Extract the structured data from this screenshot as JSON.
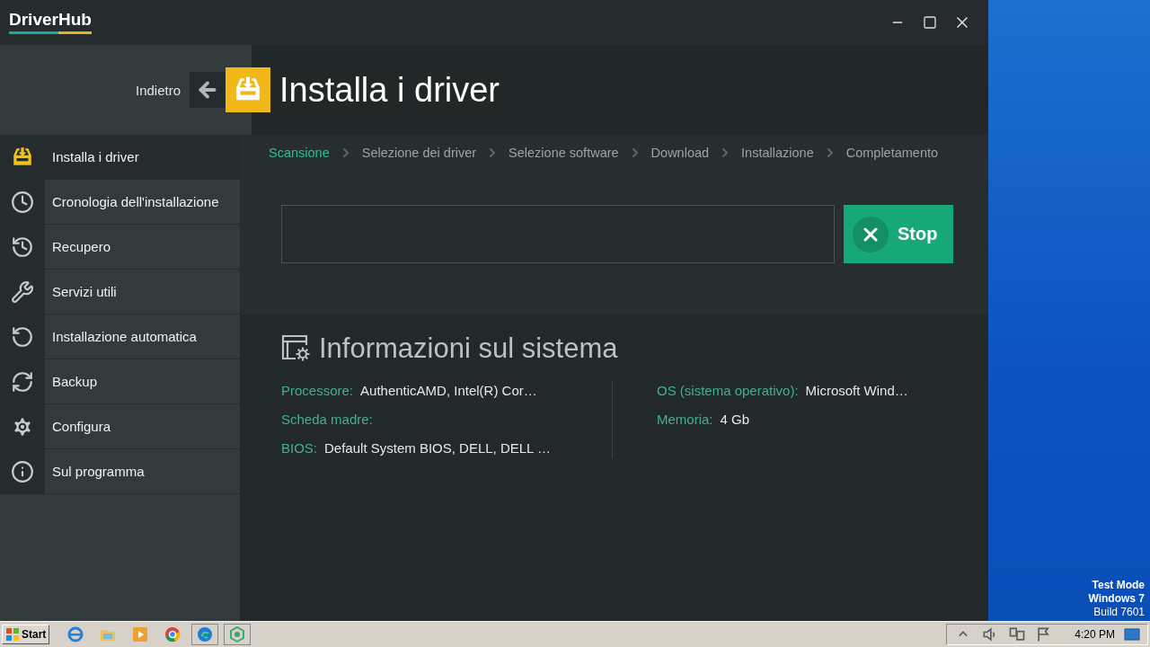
{
  "app": {
    "logo": "DriverHub"
  },
  "header": {
    "back_label": "Indietro",
    "title": "Installa i driver"
  },
  "sidebar": {
    "items": [
      {
        "label": "Installa i driver",
        "selected": true
      },
      {
        "label": "Cronologia dell'installazione",
        "selected": false
      },
      {
        "label": "Recupero",
        "selected": false
      },
      {
        "label": "Servizi utili",
        "selected": false
      },
      {
        "label": "Installazione automatica",
        "selected": false
      },
      {
        "label": "Backup",
        "selected": false
      },
      {
        "label": "Configura",
        "selected": false
      },
      {
        "label": "Sul programma",
        "selected": false
      }
    ]
  },
  "steps": [
    {
      "label": "Scansione",
      "selected": true
    },
    {
      "label": "Selezione dei driver",
      "selected": false
    },
    {
      "label": "Selezione software",
      "selected": false
    },
    {
      "label": "Download",
      "selected": false
    },
    {
      "label": "Installazione",
      "selected": false
    },
    {
      "label": "Completamento",
      "selected": false
    }
  ],
  "scan": {
    "button": "Stop"
  },
  "system_info": {
    "title": "Informazioni sul sistema",
    "left": [
      {
        "label": "Processore:",
        "value": "AuthenticAMD, Intel(R) Cor…"
      },
      {
        "label": "Scheda madre:"
      },
      {
        "label": "BIOS:",
        "value": "Default System BIOS, DELL, DELL  …"
      }
    ],
    "right": [
      {
        "label": "OS (sistema operativo):",
        "value": "Microsoft Wind…"
      },
      {
        "label": "Memoria:",
        "value": "4 Gb"
      }
    ]
  },
  "desktop": {
    "lines": [
      "Test Mode",
      "Windows 7",
      "Build 7601"
    ]
  },
  "taskbar": {
    "start": "Start",
    "clock": "4:20 PM"
  }
}
